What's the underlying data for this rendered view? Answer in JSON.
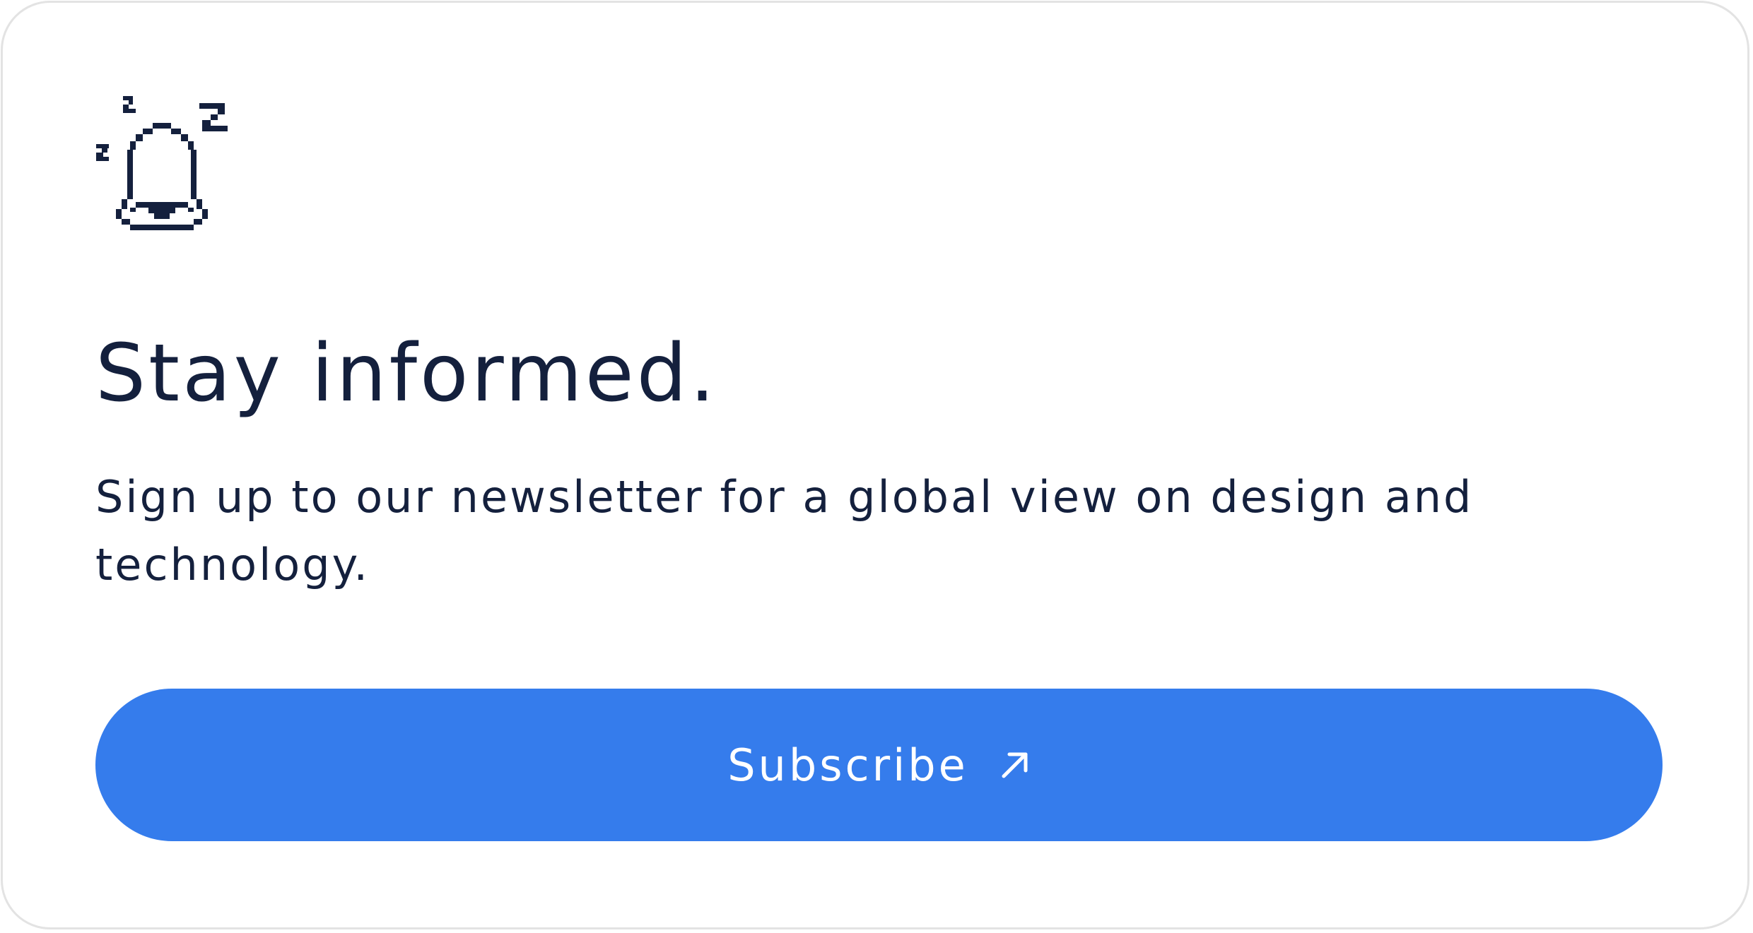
{
  "card": {
    "icon": "sleeping-pixel-bell-icon",
    "title": "Stay informed.",
    "description": "Sign up to our newsletter for a global view on design and technology.",
    "button": {
      "label": "Subscribe",
      "icon": "arrow-up-right-icon"
    }
  },
  "colors": {
    "text": "#14203d",
    "button_bg": "#357cec",
    "button_text": "#ffffff",
    "card_border": "#e3e3e3"
  }
}
